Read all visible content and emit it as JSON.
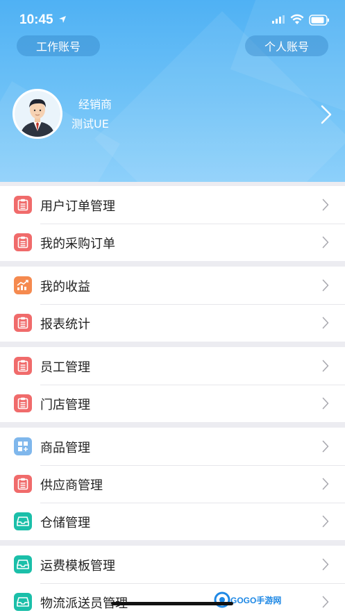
{
  "status": {
    "time": "10:45"
  },
  "accounts": {
    "work_label": "工作账号",
    "personal_label": "个人账号"
  },
  "profile": {
    "role": "经销商",
    "name": "测试UE"
  },
  "menu_groups": [
    [
      {
        "label": "用户订单管理",
        "icon": "clipboard-icon",
        "color": "#f06b6b"
      },
      {
        "label": "我的采购订单",
        "icon": "clipboard-icon",
        "color": "#f06b6b"
      }
    ],
    [
      {
        "label": "我的收益",
        "icon": "chart-up-icon",
        "color": "#f58a4f"
      },
      {
        "label": "报表统计",
        "icon": "clipboard-icon",
        "color": "#f06b6b"
      }
    ],
    [
      {
        "label": "员工管理",
        "icon": "clipboard-icon",
        "color": "#f06b6b"
      },
      {
        "label": "门店管理",
        "icon": "clipboard-icon",
        "color": "#f06b6b"
      }
    ],
    [
      {
        "label": "商品管理",
        "icon": "grid-icon",
        "color": "#7fb7ec"
      },
      {
        "label": "供应商管理",
        "icon": "clipboard-icon",
        "color": "#f06b6b"
      },
      {
        "label": "仓储管理",
        "icon": "tray-icon",
        "color": "#1bbfa9"
      }
    ],
    [
      {
        "label": "运费模板管理",
        "icon": "tray-icon",
        "color": "#1bbfa9"
      },
      {
        "label": "物流派送员管理",
        "icon": "tray-icon",
        "color": "#1bbfa9"
      }
    ]
  ],
  "watermark": {
    "text": "GOGO手游网"
  }
}
